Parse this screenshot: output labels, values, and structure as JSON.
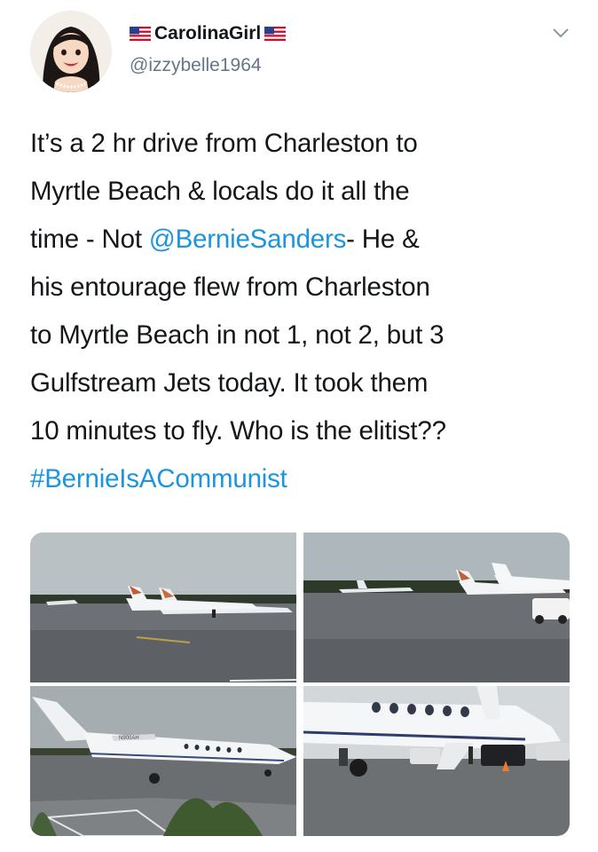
{
  "user": {
    "display_name": "CarolinaGirl",
    "handle": "@izzybelle1964",
    "name_flag_icons": [
      "us-flag-icon",
      "us-flag-icon"
    ]
  },
  "menu_icon": "chevron-down-icon",
  "tweet": {
    "lines": [
      [
        {
          "text": "It’s a 2 hr drive from Charleston to"
        }
      ],
      [
        {
          "text": "Myrtle Beach & locals do it all the"
        }
      ],
      [
        {
          "text": "time - Not "
        },
        {
          "text": "@BernieSanders",
          "link": true
        },
        {
          "text": "-  He &"
        }
      ],
      [
        {
          "text": "his entourage flew from Charleston"
        }
      ],
      [
        {
          "text": "to Myrtle Beach in not 1, not 2, but 3"
        }
      ],
      [
        {
          "text": "Gulfstream Jets today. It took them"
        }
      ],
      [
        {
          "text": "10 minutes to fly. Who is the elitist??"
        }
      ],
      [
        {
          "text": "#BernieIsACommunist",
          "link": true
        }
      ]
    ]
  },
  "media": {
    "photo_count": 4,
    "registration_text": "N900AH"
  },
  "colors": {
    "text": "#14171a",
    "secondary": "#657786",
    "link": "#1b95e0"
  }
}
